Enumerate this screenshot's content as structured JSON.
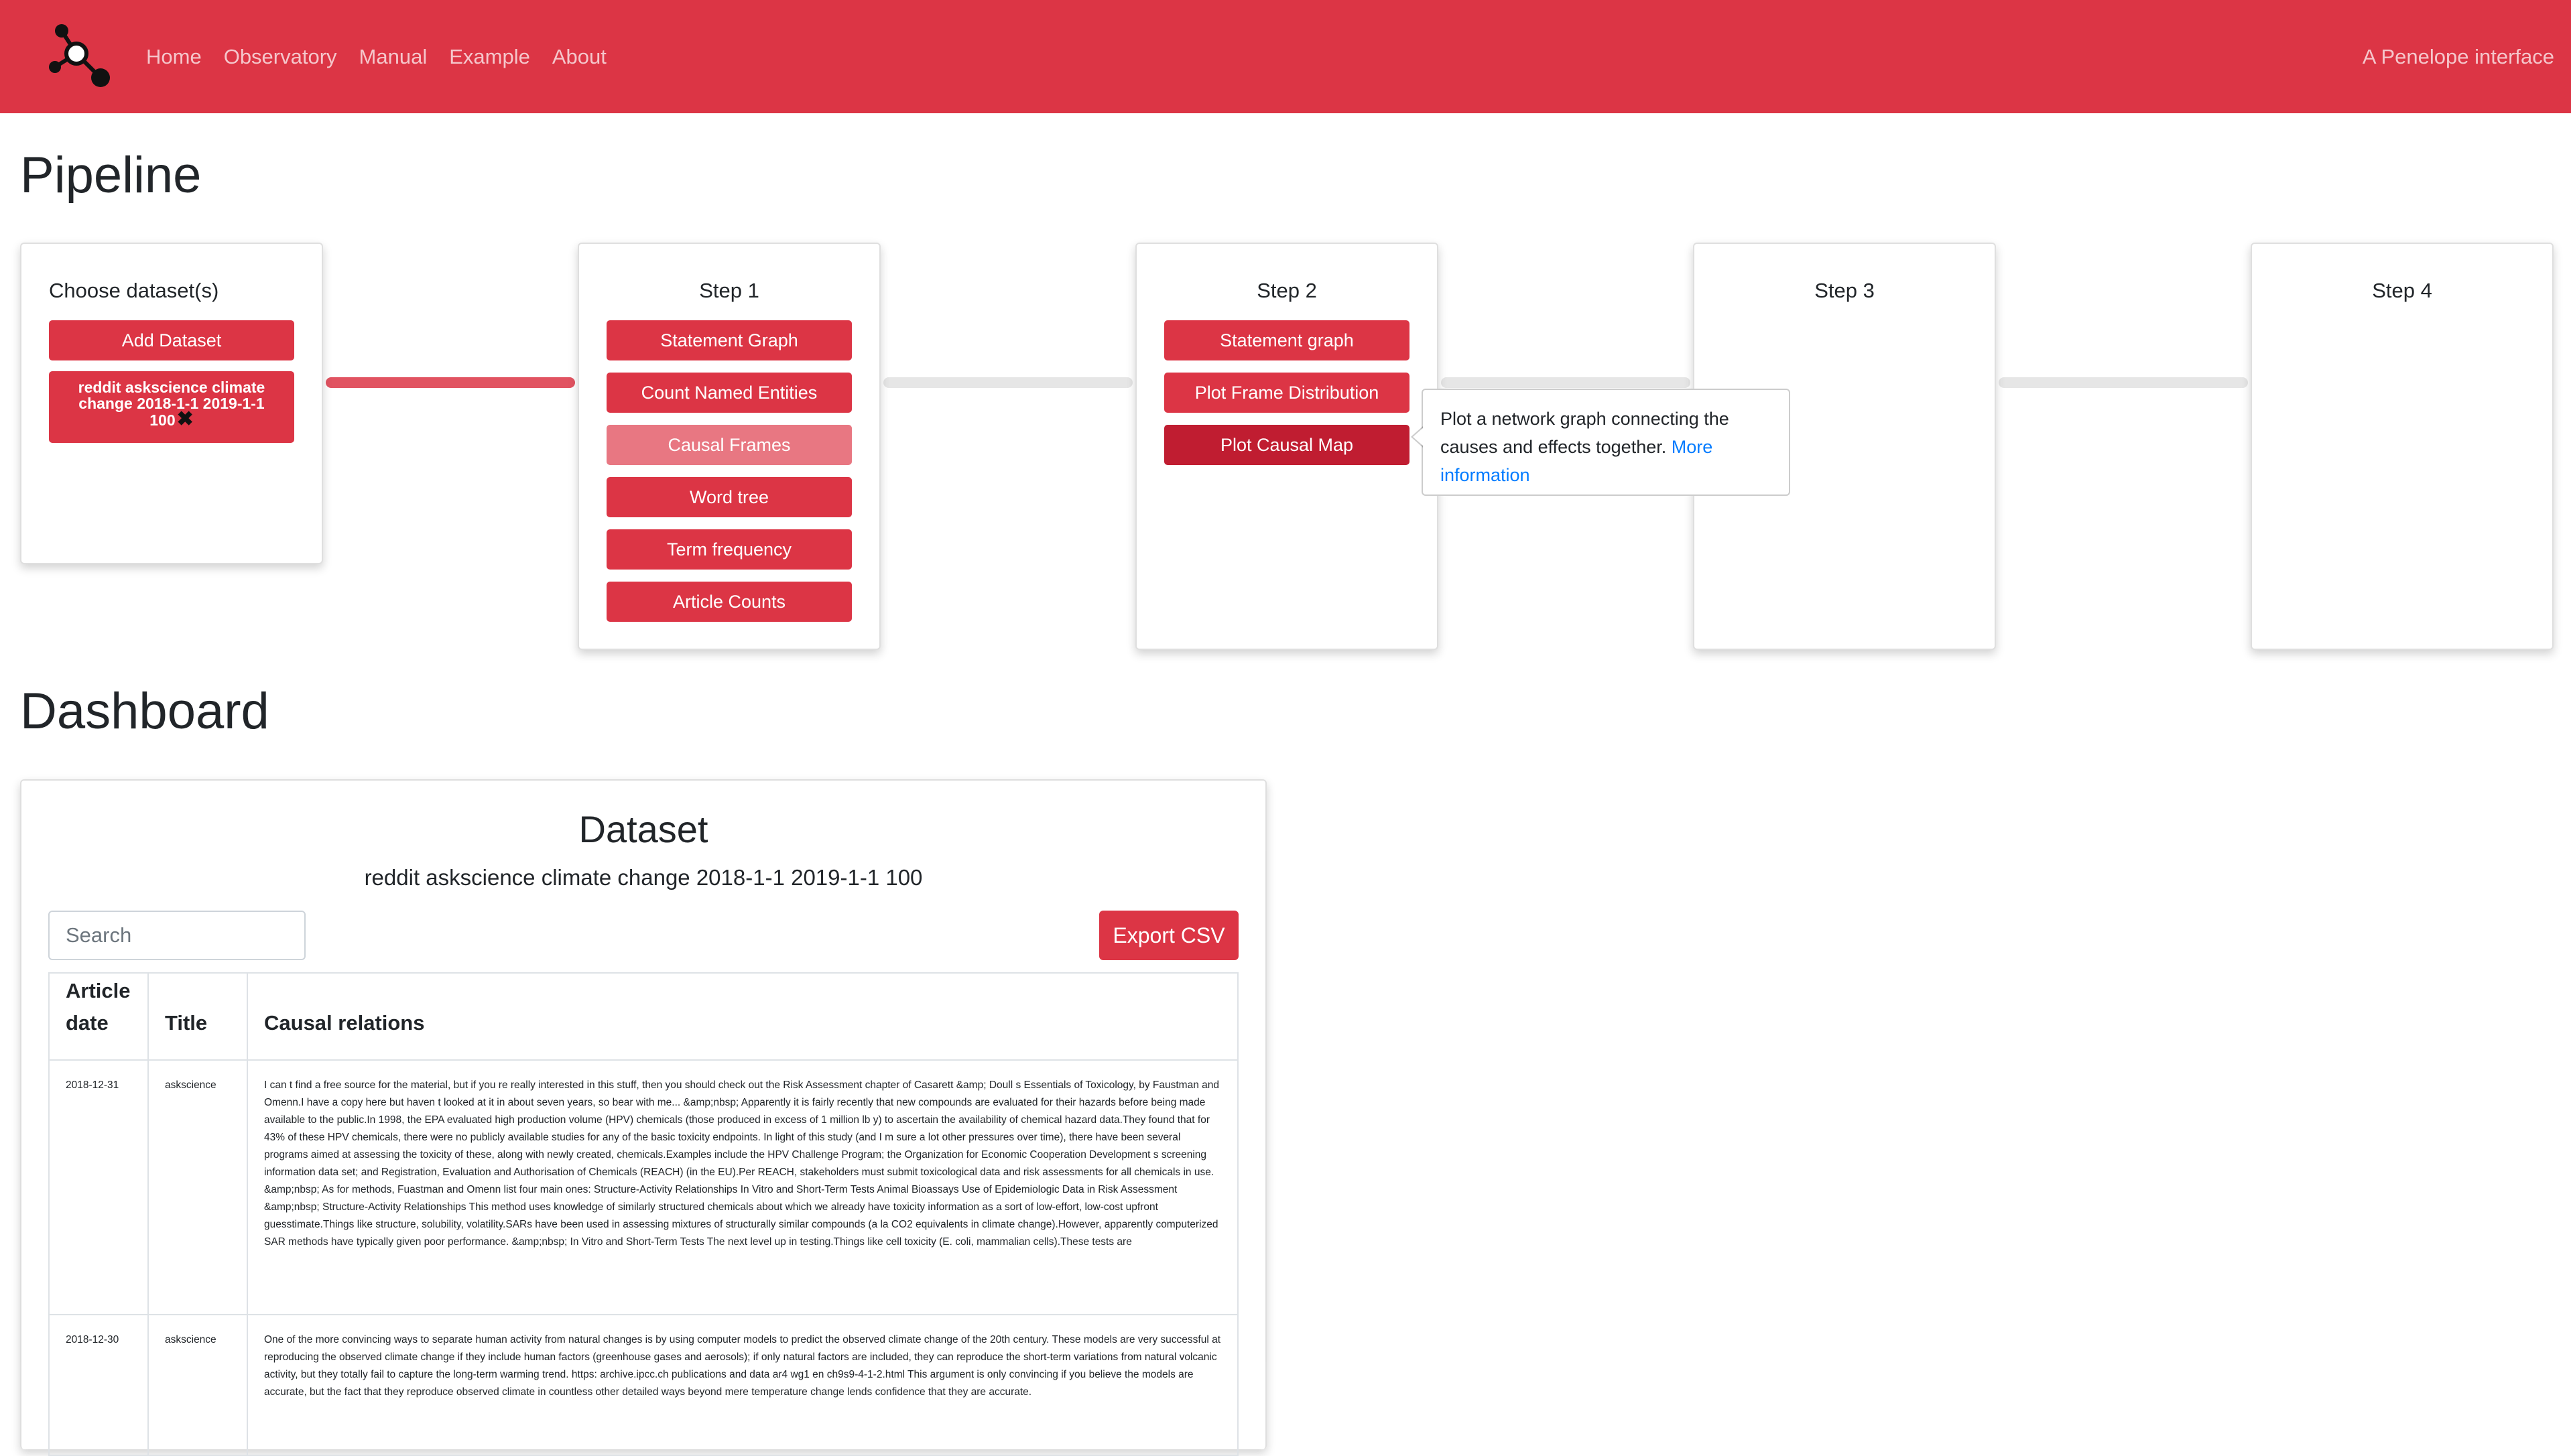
{
  "nav": {
    "links": [
      "Home",
      "Observatory",
      "Manual",
      "Example",
      "About"
    ],
    "brand_right": "A Penelope interface"
  },
  "pipeline": {
    "heading": "Pipeline",
    "choose": {
      "title": "Choose dataset(s)",
      "add_label": "Add Dataset",
      "dataset_chip": "reddit askscience climate change 2018-1-1 2019-1-1 100",
      "chip_close": "✖"
    },
    "step1": {
      "title": "Step 1",
      "buttons": [
        "Statement Graph",
        "Count Named Entities",
        "Causal Frames",
        "Word tree",
        "Term frequency",
        "Article Counts"
      ]
    },
    "step2": {
      "title": "Step 2",
      "buttons": [
        "Statement graph",
        "Plot Frame Distribution",
        "Plot Causal Map"
      ]
    },
    "step3": {
      "title": "Step 3"
    },
    "step4": {
      "title": "Step 4"
    },
    "tooltip": {
      "text": "Plot a network graph connecting the causes and effects together.",
      "link": "More information"
    }
  },
  "dashboard": {
    "heading": "Dashboard",
    "card_title": "Dataset",
    "dataset_name": "reddit askscience climate change 2018-1-1 2019-1-1 100",
    "search_placeholder": "Search",
    "export_label": "Export CSV",
    "columns": [
      "Article date",
      "Title",
      "Causal relations"
    ],
    "rows": [
      {
        "date": "2018-12-31",
        "title": "askscience",
        "text": "I can t find a free source for the material, but if you re really interested in this stuff, then you should check out the Risk Assessment chapter of Casarett &amp; Doull s Essentials of Toxicology, by Faustman and Omenn.I have a copy here but haven t looked at it in about seven years, so bear with me... &amp;nbsp; Apparently it is fairly recently that new compounds are evaluated for their hazards before being made available to the public.In 1998, the EPA evaluated high production volume (HPV) chemicals (those produced in excess of 1 million lb y) to ascertain the availability of chemical hazard data.They found that for 43% of these HPV chemicals, there were no publicly available studies for any of the basic toxicity endpoints. In light of this study (and I m sure a lot other pressures over time), there have been several programs aimed at assessing the toxicity of these, along with newly created, chemicals.Examples include the HPV Challenge Program; the Organization for Economic Cooperation Development s screening information data set; and Registration, Evaluation and Authorisation of Chemicals (REACH) (in the EU).Per REACH, stakeholders must submit toxicological data and risk assessments for all chemicals in use. &amp;nbsp; As for methods, Fuastman and Omenn list four main ones: Structure-Activity Relationships In Vitro and Short-Term Tests Animal Bioassays Use of Epidemiologic Data in Risk Assessment &amp;nbsp; Structure-Activity Relationships This method uses knowledge of similarly structured chemicals about which we already have toxicity information as a sort of low-effort, low-cost upfront guesstimate.Things like structure, solubility, volatility.SARs have been used in assessing mixtures of structurally similar compounds (a la CO2 equivalents in climate change).However, apparently computerized SAR methods have typically given poor performance. &amp;nbsp; In Vitro and Short-Term Tests The next level up in testing.Things like cell toxicity (E. coli, mammalian cells).These tests are"
      },
      {
        "date": "2018-12-30",
        "title": "askscience",
        "text": "One of the more convincing ways to separate human activity from natural changes is by using computer models to predict the observed climate change of the 20th century. These models are very successful at reproducing the observed climate change if they include human factors (greenhouse gases and aerosols); if only natural factors are included, they can reproduce the short-term variations from natural volcanic activity, but they totally fail to capture the long-term warming trend. https: archive.ipcc.ch publications and data ar4 wg1 en ch9s9-4-1-2.html This argument is only convincing if you believe the models are accurate, but the fact that they reproduce observed climate in countless other detailed ways beyond mere temperature change lends confidence that they are accurate."
      }
    ]
  }
}
